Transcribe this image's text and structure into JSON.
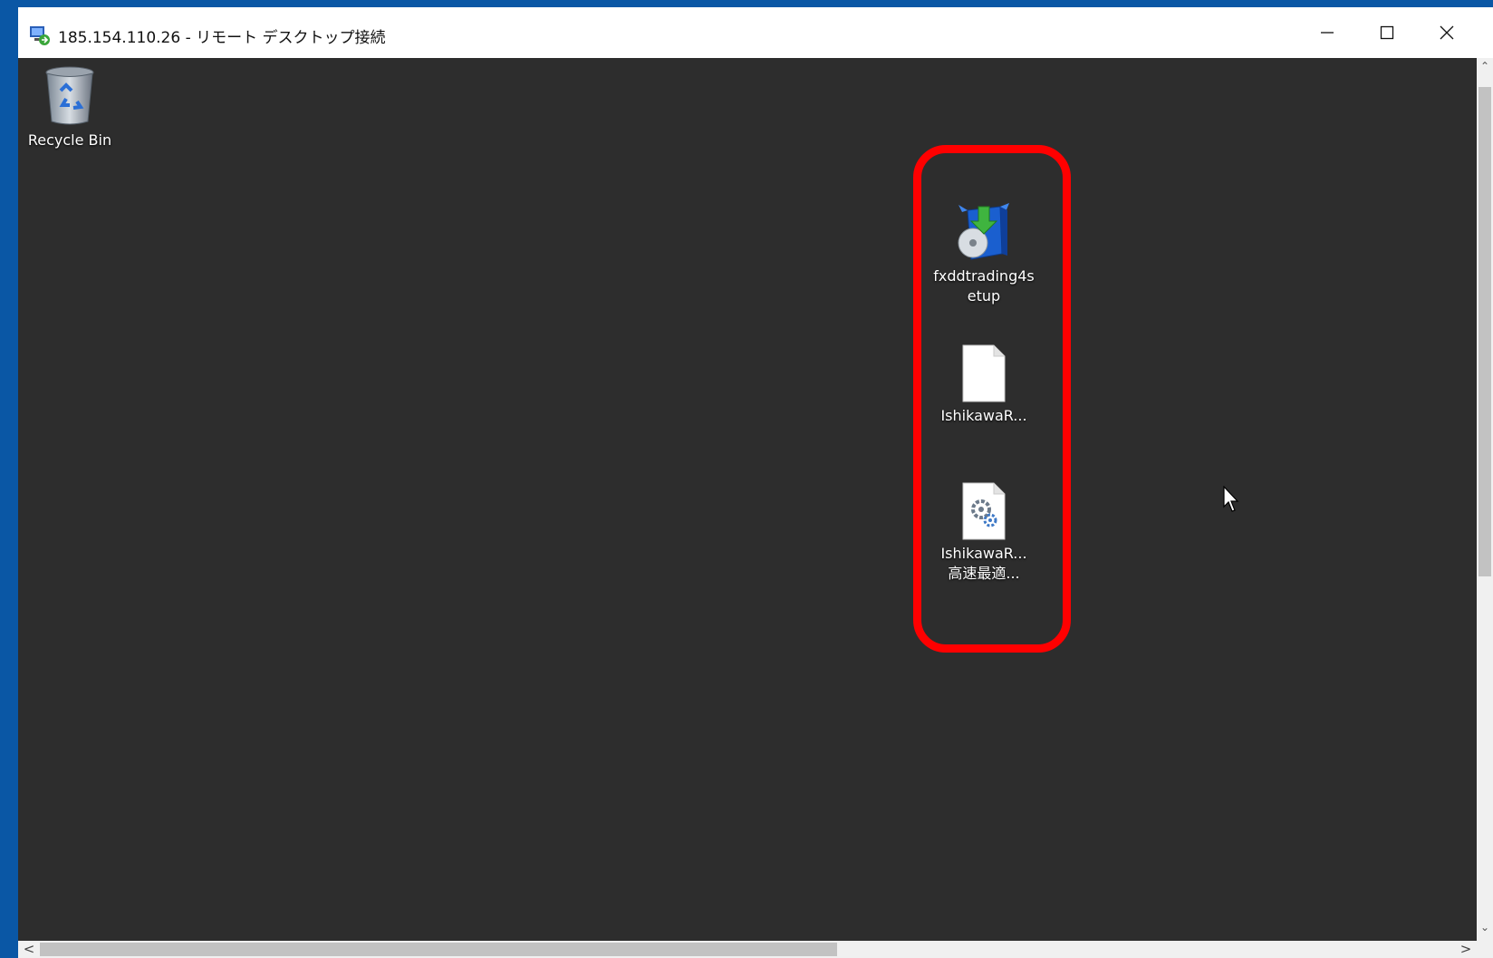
{
  "window": {
    "title": "185.154.110.26 - リモート デスクトップ接続",
    "controls": {
      "minimize": "—",
      "maximize": "☐",
      "close": "✕"
    }
  },
  "desktop": {
    "background": "#2d2d2d",
    "icons": [
      {
        "label": "Recycle Bin",
        "icon": "recycle-bin-icon"
      },
      {
        "label": "fxddtrading4s\netup",
        "icon": "installer-icon"
      },
      {
        "label": "IshikawaR...",
        "icon": "blank-file-icon"
      },
      {
        "label": "IshikawaR...\n高速最適...",
        "icon": "settings-file-icon"
      }
    ]
  },
  "highlight_color": "#ff0000",
  "scrollbars": {
    "left_arrow": "<",
    "right_arrow": ">"
  }
}
